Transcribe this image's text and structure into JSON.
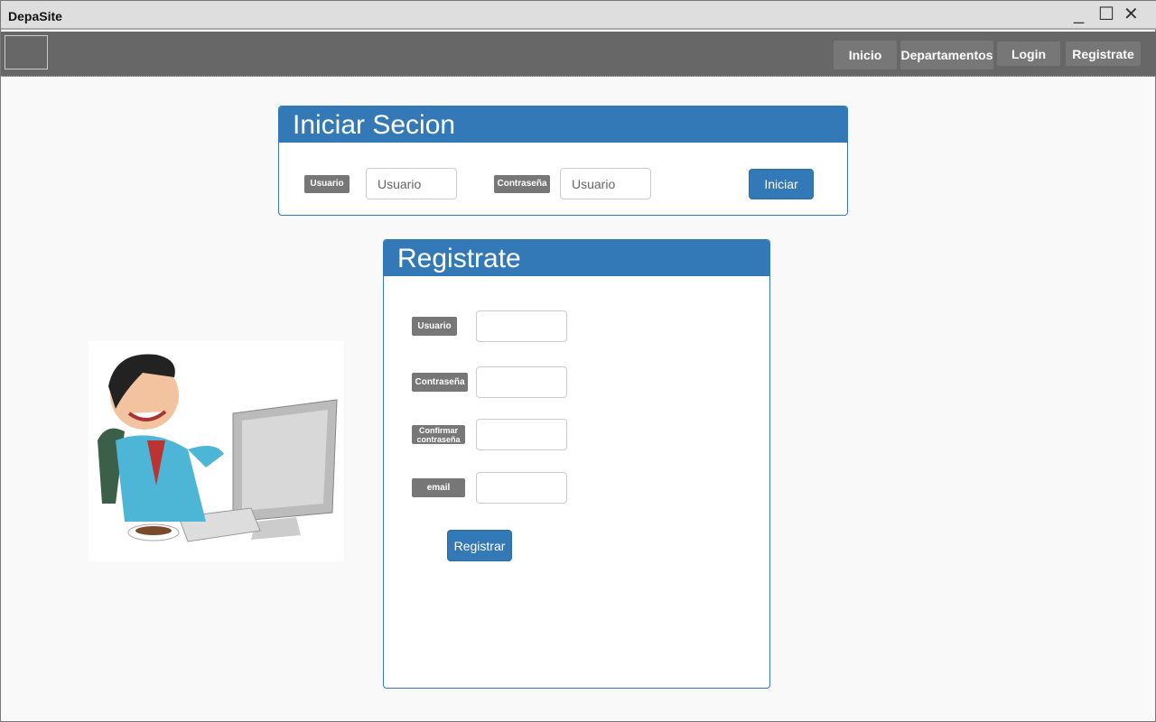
{
  "window": {
    "title": "DepaSite",
    "minimize": "_",
    "maximize": "☐",
    "close": "✕"
  },
  "nav": {
    "items": [
      "Inicio",
      "Departamentos",
      "Login",
      "Registrate"
    ]
  },
  "login": {
    "title": "Iniciar Secion",
    "user_label": "Usuario",
    "user_placeholder": "Usuario",
    "pass_label": "Contraseña",
    "pass_placeholder": "Usuario",
    "submit": "Iniciar"
  },
  "register": {
    "title": "Registrate",
    "user_label": "Usuario",
    "pass_label": "Contraseña",
    "confirm_label": "Confirmar contraseña",
    "email_label": "email",
    "submit": "Registrar"
  },
  "colors": {
    "primary": "#3479b7",
    "nav": "#676767",
    "label": "#777777"
  }
}
